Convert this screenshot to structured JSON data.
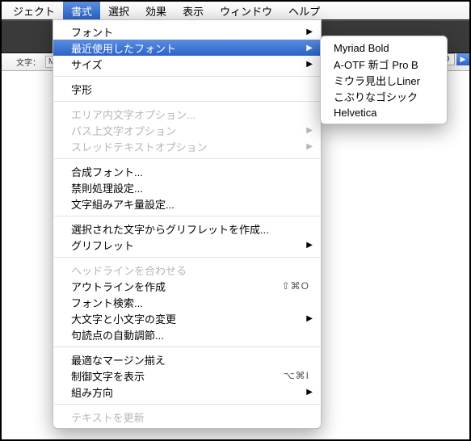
{
  "menubar": {
    "items": [
      "ジェクト",
      "書式",
      "選択",
      "効果",
      "表示",
      "ウィンドウ",
      "ヘルプ"
    ],
    "activeIndex": 1
  },
  "subbar": {
    "label": "文字：",
    "fieldFragment": "M"
  },
  "rightStrip": {
    "value": "0",
    "icon": "▶"
  },
  "dropdown": [
    {
      "type": "item",
      "label": "フォント",
      "submenu": true
    },
    {
      "type": "item",
      "label": "最近使用したフォント",
      "submenu": true,
      "highlight": true
    },
    {
      "type": "item",
      "label": "サイズ",
      "submenu": true
    },
    {
      "type": "sep"
    },
    {
      "type": "item",
      "label": "字形"
    },
    {
      "type": "sep"
    },
    {
      "type": "item",
      "label": "エリア内文字オプション...",
      "disabled": true
    },
    {
      "type": "item",
      "label": "パス上文字オプション",
      "submenu": true,
      "disabled": true
    },
    {
      "type": "item",
      "label": "スレッドテキストオプション",
      "submenu": true,
      "disabled": true
    },
    {
      "type": "sep"
    },
    {
      "type": "item",
      "label": "合成フォント..."
    },
    {
      "type": "item",
      "label": "禁則処理設定..."
    },
    {
      "type": "item",
      "label": "文字組みアキ量設定..."
    },
    {
      "type": "sep"
    },
    {
      "type": "item",
      "label": "選択された文字からグリフレットを作成..."
    },
    {
      "type": "item",
      "label": "グリフレット",
      "submenu": true
    },
    {
      "type": "sep"
    },
    {
      "type": "item",
      "label": "ヘッドラインを合わせる",
      "disabled": true
    },
    {
      "type": "item",
      "label": "アウトラインを作成",
      "shortcut": "⇧⌘O"
    },
    {
      "type": "item",
      "label": "フォント検索..."
    },
    {
      "type": "item",
      "label": "大文字と小文字の変更",
      "submenu": true
    },
    {
      "type": "item",
      "label": "句読点の自動調節..."
    },
    {
      "type": "sep"
    },
    {
      "type": "item",
      "label": "最適なマージン揃え"
    },
    {
      "type": "item",
      "label": "制御文字を表示",
      "shortcut": "⌥⌘I"
    },
    {
      "type": "item",
      "label": "組み方向",
      "submenu": true
    },
    {
      "type": "sep"
    },
    {
      "type": "item",
      "label": "テキストを更新",
      "disabled": true
    }
  ],
  "submenu": {
    "items": [
      "Myriad Bold",
      "A-OTF 新ゴ Pro B",
      "ミウラ見出しLiner",
      "こぶりなゴシック",
      "Helvetica"
    ]
  }
}
